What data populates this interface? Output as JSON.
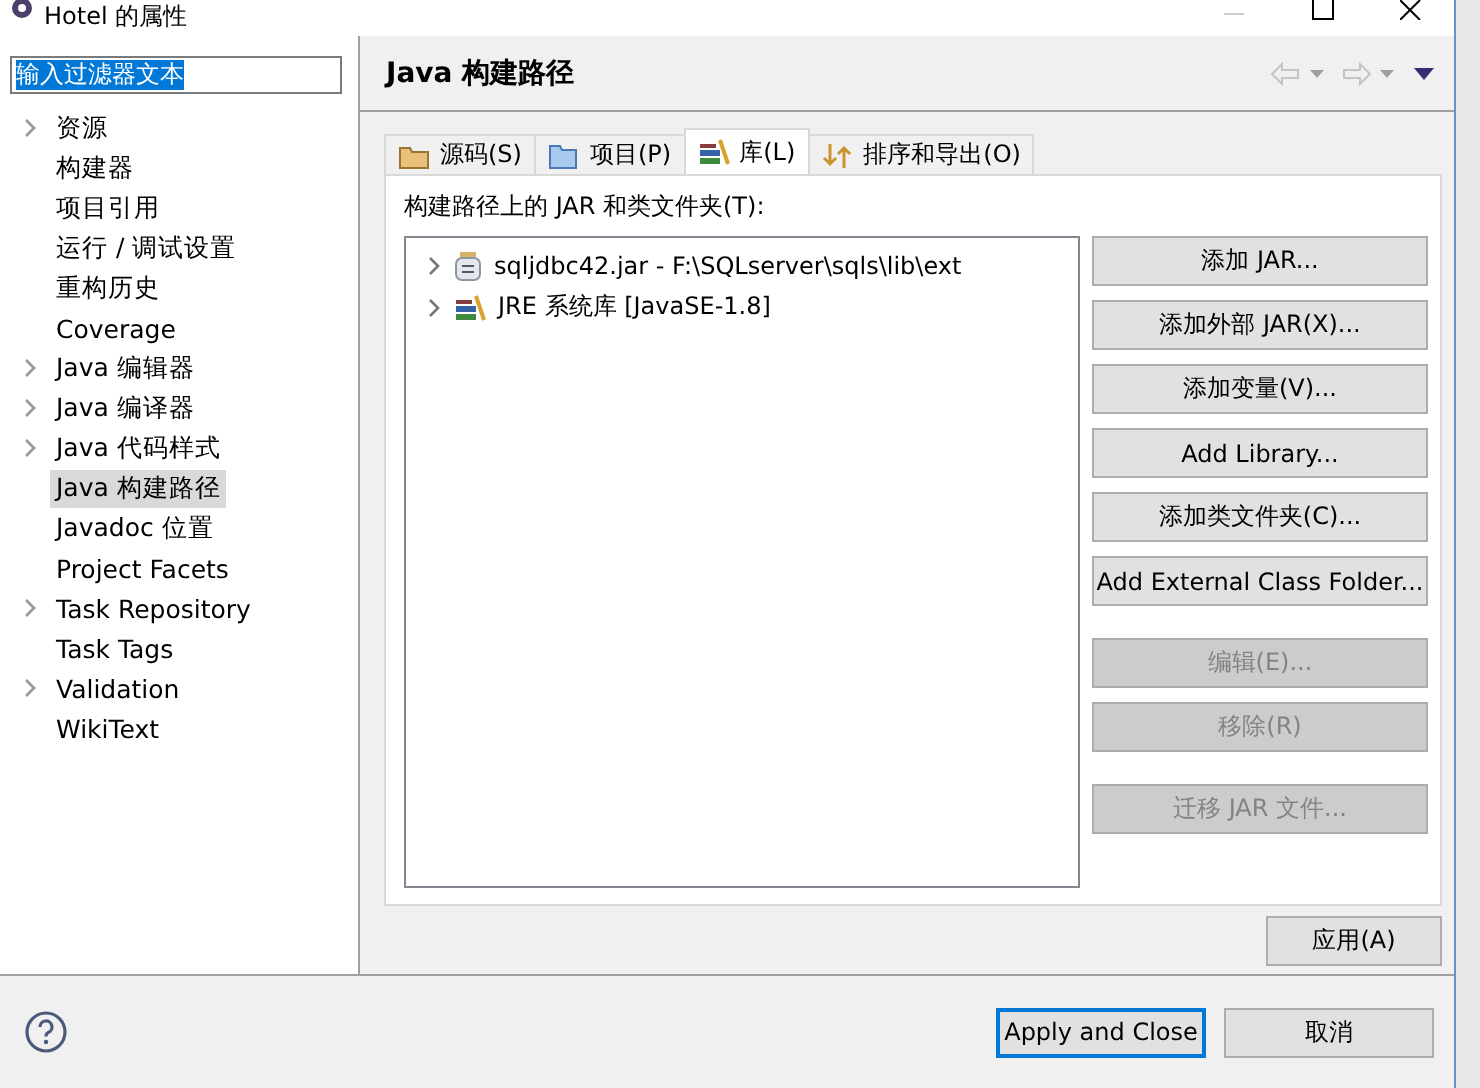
{
  "window": {
    "title": "Hotel 的属性"
  },
  "filter": {
    "value": "输入过滤器文本"
  },
  "tree": [
    {
      "label": "资源",
      "expandable": true,
      "selected": false
    },
    {
      "label": "构建器",
      "expandable": false,
      "selected": false
    },
    {
      "label": "项目引用",
      "expandable": false,
      "selected": false
    },
    {
      "label": "运行 / 调试设置",
      "expandable": false,
      "selected": false
    },
    {
      "label": "重构历史",
      "expandable": false,
      "selected": false
    },
    {
      "label": "Coverage",
      "expandable": false,
      "selected": false
    },
    {
      "label": "Java 编辑器",
      "expandable": true,
      "selected": false
    },
    {
      "label": "Java 编译器",
      "expandable": true,
      "selected": false
    },
    {
      "label": "Java 代码样式",
      "expandable": true,
      "selected": false
    },
    {
      "label": "Java 构建路径",
      "expandable": false,
      "selected": true
    },
    {
      "label": "Javadoc 位置",
      "expandable": false,
      "selected": false
    },
    {
      "label": "Project Facets",
      "expandable": false,
      "selected": false
    },
    {
      "label": "Task Repository",
      "expandable": true,
      "selected": false
    },
    {
      "label": "Task Tags",
      "expandable": false,
      "selected": false
    },
    {
      "label": "Validation",
      "expandable": true,
      "selected": false
    },
    {
      "label": "WikiText",
      "expandable": false,
      "selected": false
    }
  ],
  "page_title": "Java 构建路径",
  "tabs": [
    {
      "label": "源码(S)",
      "kind": "source",
      "selected": false
    },
    {
      "label": "项目(P)",
      "kind": "project",
      "selected": false
    },
    {
      "label": "库(L)",
      "kind": "library",
      "selected": true
    },
    {
      "label": "排序和导出(O)",
      "kind": "order",
      "selected": false
    }
  ],
  "list_label": "构建路径上的 JAR 和类文件夹(T):",
  "entries": [
    {
      "label": "sqljdbc42.jar - F:\\SQLserver\\sqls\\lib\\ext",
      "kind": "jar"
    },
    {
      "label": "JRE 系统库 [JavaSE-1.8]",
      "kind": "library"
    }
  ],
  "buttons": [
    {
      "label": "添加 JAR...",
      "disabled": false
    },
    {
      "label": "添加外部 JAR(X)...",
      "disabled": false
    },
    {
      "label": "添加变量(V)...",
      "disabled": false
    },
    {
      "label": "Add Library...",
      "disabled": false
    },
    {
      "label": "添加类文件夹(C)...",
      "disabled": false
    },
    {
      "label": "Add External Class Folder...",
      "disabled": false
    },
    {
      "label": "编辑(E)...",
      "disabled": true
    },
    {
      "label": "移除(R)",
      "disabled": true
    },
    {
      "label": "迁移 JAR 文件...",
      "disabled": true
    }
  ],
  "apply": "应用(A)",
  "footer_buttons": [
    {
      "label": "Apply and Close",
      "default": true
    },
    {
      "label": "取消",
      "default": false
    }
  ]
}
